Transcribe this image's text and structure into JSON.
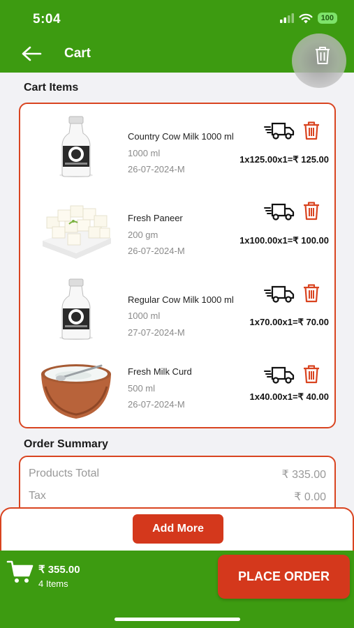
{
  "status_bar": {
    "time": "5:04",
    "battery": "100"
  },
  "header": {
    "title": "Cart"
  },
  "cart_section_title": "Cart Items",
  "items": [
    {
      "name": "Country Cow Milk 1000 ml",
      "size": "1000 ml",
      "date": "26-07-2024-M",
      "price": "1x125.00x1=₹ 125.00",
      "image": "milk-bottle"
    },
    {
      "name": "Fresh Paneer",
      "size": "200 gm",
      "date": "26-07-2024-M",
      "price": "1x100.00x1=₹ 100.00",
      "image": "paneer"
    },
    {
      "name": "Regular Cow Milk 1000 ml",
      "size": "1000 ml",
      "date": "27-07-2024-M",
      "price": "1x70.00x1=₹ 70.00",
      "image": "milk-bottle"
    },
    {
      "name": "Fresh Milk Curd",
      "size": "500 ml",
      "date": "26-07-2024-M",
      "price": "1x40.00x1=₹ 40.00",
      "image": "curd-bowl"
    }
  ],
  "summary_title": "Order Summary",
  "summary": {
    "products_total_label": "Products Total",
    "products_total_value": "₹ 335.00",
    "tax_label": "Tax",
    "tax_value": "₹ 0.00"
  },
  "add_more_label": "Add More",
  "footer": {
    "total": "₹ 355.00",
    "items_count": "4 Items",
    "place_order_label": "PLACE ORDER"
  },
  "colors": {
    "brand_green": "#3d9b11",
    "accent_red": "#d4381c",
    "border_red": "#d94420"
  }
}
